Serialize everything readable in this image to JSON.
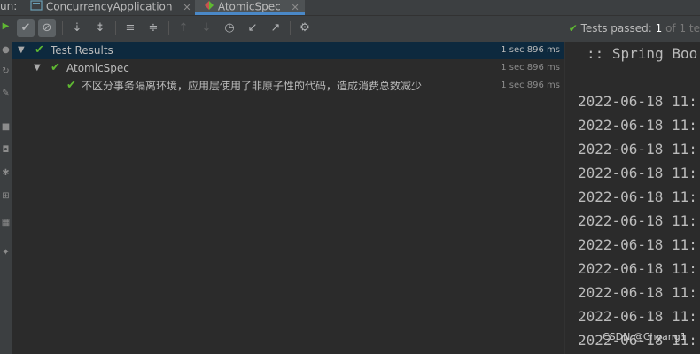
{
  "run_label": "un:",
  "tabs": [
    {
      "label": "ConcurrencyApplication",
      "icon": "application-config-icon",
      "active": false
    },
    {
      "label": "AtomicSpec",
      "icon": "spock-spec-icon",
      "active": true
    }
  ],
  "toolbar": {
    "status_prefix": "Tests passed: ",
    "passed": "1",
    "status_suffix": " of 1 te"
  },
  "tree": {
    "rows": [
      {
        "label": "Test Results",
        "duration": "1 sec 896 ms"
      },
      {
        "label": "AtomicSpec",
        "duration": "1 sec 896 ms"
      },
      {
        "label": "不区分事务隔离环境，应用层使用了非原子性的代码，造成消费总数减少",
        "duration": "1 sec 896 ms"
      }
    ]
  },
  "console": {
    "banner": ":: Spring Boo",
    "lines": [
      "2022-06-18 11:",
      "2022-06-18 11:",
      "2022-06-18 11:",
      "2022-06-18 11:",
      "2022-06-18 11:",
      "2022-06-18 11:",
      "2022-06-18 11:",
      "2022-06-18 11:",
      "2022-06-18 11:",
      "2022-06-18 11:",
      "2022-06-18 11:"
    ]
  },
  "watermark": "CSDN @Chyang1",
  "colors": {
    "pass_green": "#5fb832",
    "selection": "#0d293e",
    "accent_blue": "#4a88c7"
  }
}
